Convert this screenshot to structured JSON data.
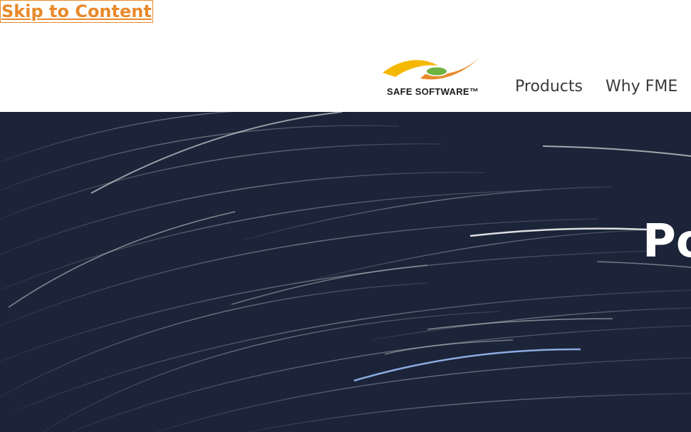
{
  "skip_link": {
    "label": "Skip to Content"
  },
  "header": {
    "logo": {
      "text": "SAFE SOFTWARE™",
      "icon": "safe-software-swoosh-logo"
    },
    "nav": [
      {
        "label": "Products"
      },
      {
        "label": "Why FME"
      }
    ]
  },
  "hero": {
    "title": "Po",
    "background": "star-trails-night-sky"
  },
  "colors": {
    "accent": "#e8892a",
    "hero_bg": "#1b2438",
    "logo_yellow": "#f5b800",
    "logo_orange": "#e8892a",
    "logo_green": "#6cb33f"
  }
}
